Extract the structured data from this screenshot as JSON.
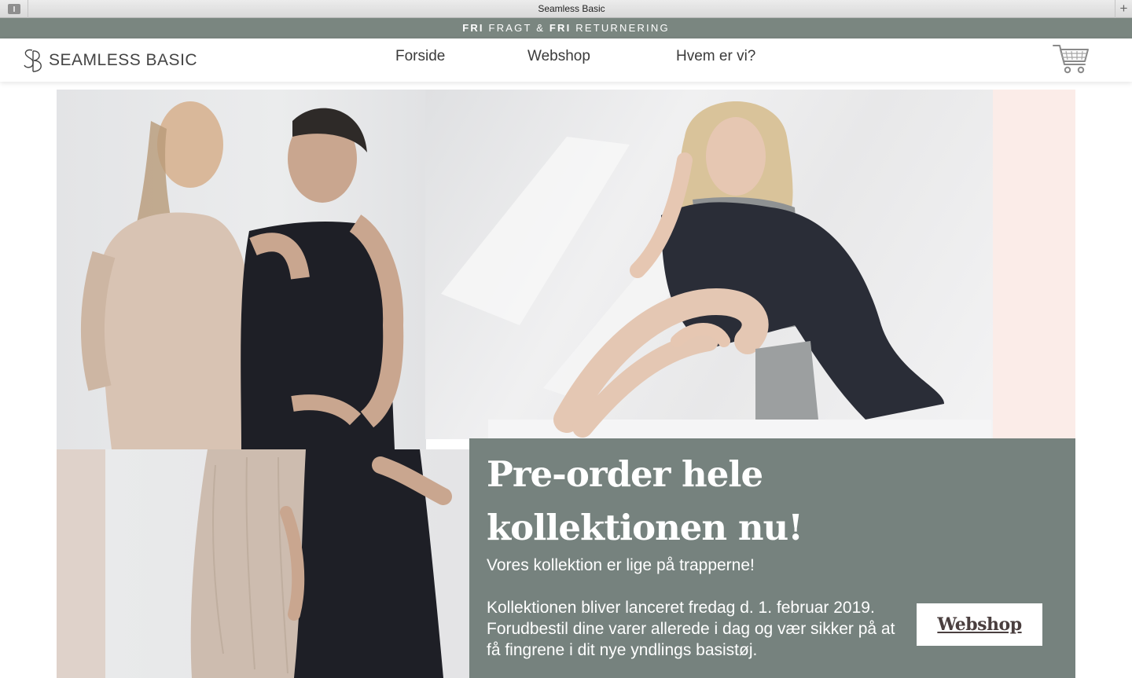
{
  "browser": {
    "window_title": "Seamless Basic"
  },
  "promo_bar": {
    "part1_bold": "FRI",
    "part1": " FRAGT & ",
    "part2_bold": "FRI",
    "part2": " RETURNERING"
  },
  "header": {
    "logo_text": "SEAMLESS BASIC",
    "nav": [
      {
        "label": "Forside"
      },
      {
        "label": "Webshop"
      },
      {
        "label": "Hvem er vi?"
      }
    ],
    "cart_icon": "shopping-cart-icon"
  },
  "hero": {
    "headline": "Pre-order hele kollektionen nu!",
    "subline": "Vores kollektion er lige på trapperne!",
    "body": "Kollektionen bliver lanceret fredag d. 1. februar 2019. Forudbestil dine varer allerede i dag og vær sikker på at få fingrene i dit nye yndlings basistøj.",
    "button_label": "Webshop"
  },
  "colors": {
    "promo_bar": "#7a8680",
    "promo_box": "#76827e",
    "pink_accent": "#fbece8",
    "sand_accent": "#dfd2ca",
    "text_dark": "#3a3a3a"
  }
}
